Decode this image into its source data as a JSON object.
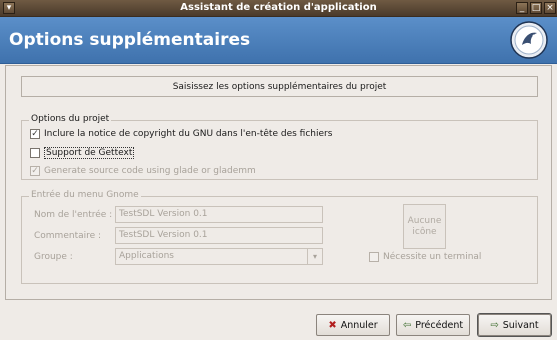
{
  "window": {
    "title": "Assistant de création d'application"
  },
  "banner": {
    "heading": "Options supplémentaires"
  },
  "info": {
    "text": "Saisissez les options supplémentaires du projet"
  },
  "project_options": {
    "label": "Options du projet",
    "copyright": {
      "label": "Inclure la notice de copyright du GNU dans l'en-tête des fichiers",
      "checked": true
    },
    "gettext": {
      "label": "Support de Gettext",
      "checked": false
    },
    "glade": {
      "label": "Generate source code using glade or glademm",
      "checked": true
    }
  },
  "gnome_menu": {
    "label": "Entrée du menu Gnome",
    "name_label": "Nom de l'entrée :",
    "name_value": "TestSDL Version 0.1",
    "comment_label": "Commentaire :",
    "comment_value": "TestSDL Version 0.1",
    "group_label": "Groupe :",
    "group_value": "Applications",
    "icon_label": "Aucune icône",
    "terminal_label": "Nécessite un terminal"
  },
  "buttons": {
    "cancel": "Annuler",
    "previous": "Précédent",
    "next": "Suivant"
  }
}
